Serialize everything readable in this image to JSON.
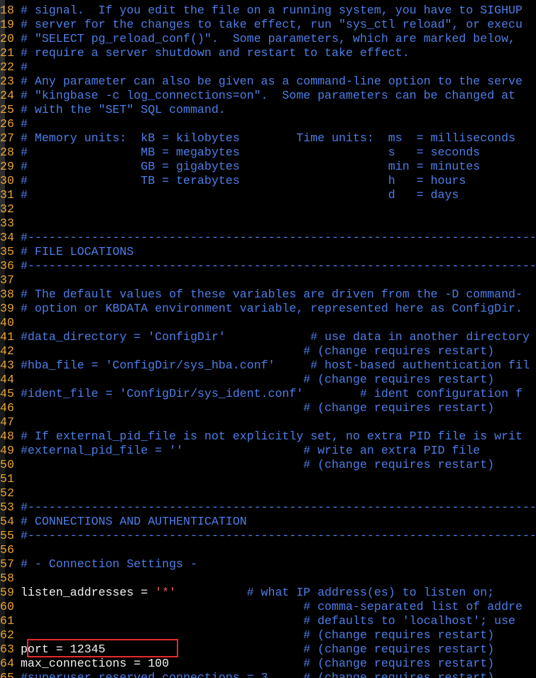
{
  "editor": {
    "lines": [
      {
        "num": "18",
        "segments": [
          {
            "t": "c",
            "s": "# signal.  If you edit the file on a running system, you have to SIGHUP"
          }
        ]
      },
      {
        "num": "19",
        "segments": [
          {
            "t": "c",
            "s": "# server for the changes to take effect, run \"sys_ctl reload\", or execu"
          }
        ]
      },
      {
        "num": "20",
        "segments": [
          {
            "t": "c",
            "s": "# \"SELECT pg_reload_conf()\".  Some parameters, which are marked below,"
          }
        ]
      },
      {
        "num": "21",
        "segments": [
          {
            "t": "c",
            "s": "# require a server shutdown and restart to take effect."
          }
        ]
      },
      {
        "num": "22",
        "segments": [
          {
            "t": "c",
            "s": "#"
          }
        ]
      },
      {
        "num": "23",
        "segments": [
          {
            "t": "c",
            "s": "# Any parameter can also be given as a command-line option to the serve"
          }
        ]
      },
      {
        "num": "24",
        "segments": [
          {
            "t": "c",
            "s": "# \"kingbase -c log_connections=on\".  Some parameters can be changed at"
          }
        ]
      },
      {
        "num": "25",
        "segments": [
          {
            "t": "c",
            "s": "# with the \"SET\" SQL command."
          }
        ]
      },
      {
        "num": "26",
        "segments": [
          {
            "t": "c",
            "s": "#"
          }
        ]
      },
      {
        "num": "27",
        "segments": [
          {
            "t": "c",
            "s": "# Memory units:  kB = kilobytes        Time units:  ms  = milliseconds"
          }
        ]
      },
      {
        "num": "28",
        "segments": [
          {
            "t": "c",
            "s": "#                MB = megabytes                     s   = seconds"
          }
        ]
      },
      {
        "num": "29",
        "segments": [
          {
            "t": "c",
            "s": "#                GB = gigabytes                     min = minutes"
          }
        ]
      },
      {
        "num": "30",
        "segments": [
          {
            "t": "c",
            "s": "#                TB = terabytes                     h   = hours"
          }
        ]
      },
      {
        "num": "31",
        "segments": [
          {
            "t": "c",
            "s": "#                                                   d   = days"
          }
        ]
      },
      {
        "num": "32",
        "segments": []
      },
      {
        "num": "33",
        "segments": []
      },
      {
        "num": "34",
        "segments": [
          {
            "t": "c",
            "s": "#------------------------------------------------------------------------------"
          }
        ]
      },
      {
        "num": "35",
        "segments": [
          {
            "t": "c",
            "s": "# FILE LOCATIONS"
          }
        ]
      },
      {
        "num": "36",
        "segments": [
          {
            "t": "c",
            "s": "#------------------------------------------------------------------------------"
          }
        ]
      },
      {
        "num": "37",
        "segments": []
      },
      {
        "num": "38",
        "segments": [
          {
            "t": "c",
            "s": "# The default values of these variables are driven from the -D command-"
          }
        ]
      },
      {
        "num": "39",
        "segments": [
          {
            "t": "c",
            "s": "# option or KBDATA environment variable, represented here as ConfigDir."
          }
        ]
      },
      {
        "num": "40",
        "segments": []
      },
      {
        "num": "41",
        "segments": [
          {
            "t": "c",
            "s": "#data_directory = 'ConfigDir'            # use data in another directory"
          }
        ]
      },
      {
        "num": "42",
        "segments": [
          {
            "t": "c",
            "s": "                                        # (change requires restart)"
          }
        ]
      },
      {
        "num": "43",
        "segments": [
          {
            "t": "c",
            "s": "#hba_file = 'ConfigDir/sys_hba.conf'     # host-based authentication fil"
          }
        ]
      },
      {
        "num": "44",
        "segments": [
          {
            "t": "c",
            "s": "                                        # (change requires restart)"
          }
        ]
      },
      {
        "num": "45",
        "segments": [
          {
            "t": "c",
            "s": "#ident_file = 'ConfigDir/sys_ident.conf'        # ident configuration f"
          }
        ]
      },
      {
        "num": "46",
        "segments": [
          {
            "t": "c",
            "s": "                                        # (change requires restart)"
          }
        ]
      },
      {
        "num": "47",
        "segments": []
      },
      {
        "num": "48",
        "segments": [
          {
            "t": "c",
            "s": "# If external_pid_file is not explicitly set, no extra PID file is writ"
          }
        ]
      },
      {
        "num": "49",
        "segments": [
          {
            "t": "c",
            "s": "#external_pid_file = ''                 # write an extra PID file"
          }
        ]
      },
      {
        "num": "50",
        "segments": [
          {
            "t": "c",
            "s": "                                        # (change requires restart)"
          }
        ]
      },
      {
        "num": "51",
        "segments": []
      },
      {
        "num": "52",
        "segments": []
      },
      {
        "num": "53",
        "segments": [
          {
            "t": "c",
            "s": "#------------------------------------------------------------------------------"
          }
        ]
      },
      {
        "num": "54",
        "segments": [
          {
            "t": "c",
            "s": "# CONNECTIONS AND AUTHENTICATION"
          }
        ]
      },
      {
        "num": "55",
        "segments": [
          {
            "t": "c",
            "s": "#------------------------------------------------------------------------------"
          }
        ]
      },
      {
        "num": "56",
        "segments": []
      },
      {
        "num": "57",
        "segments": [
          {
            "t": "c",
            "s": "# - Connection Settings -"
          }
        ]
      },
      {
        "num": "58",
        "segments": []
      },
      {
        "num": "59",
        "segments": [
          {
            "t": "n",
            "s": "listen_addresses = "
          },
          {
            "t": "s",
            "s": "'*'"
          },
          {
            "t": "c",
            "s": "          # what IP address(es) to listen on;"
          }
        ]
      },
      {
        "num": "60",
        "segments": [
          {
            "t": "c",
            "s": "                                        # comma-separated list of addre"
          }
        ]
      },
      {
        "num": "61",
        "segments": [
          {
            "t": "c",
            "s": "                                        # defaults to 'localhost'; use"
          }
        ]
      },
      {
        "num": "62",
        "segments": [
          {
            "t": "c",
            "s": "                                        # (change requires restart)"
          }
        ]
      },
      {
        "num": "63",
        "segments": [
          {
            "t": "n",
            "s": "port = 12345"
          },
          {
            "t": "c",
            "s": "                            # (change requires restart)"
          }
        ]
      },
      {
        "num": "64",
        "segments": [
          {
            "t": "n",
            "s": "max_connections = 100"
          },
          {
            "t": "c",
            "s": "                   # (change requires restart)"
          }
        ]
      },
      {
        "num": "65",
        "segments": [
          {
            "t": "c",
            "s": "#superuser_reserved_connections = 3     # (change requires restart)"
          }
        ]
      }
    ]
  },
  "highlight": {
    "color": "#e32b2b",
    "line": "63"
  },
  "colors": {
    "background": "#000000",
    "line_number": "#e6a333",
    "comment": "#4d7ee8",
    "string": "#e85a5a",
    "text": "#f1f1f1"
  }
}
